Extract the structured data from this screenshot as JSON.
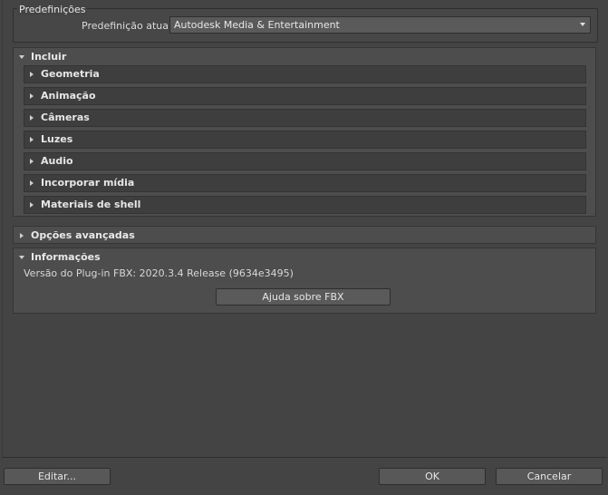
{
  "presets": {
    "title": "Predefinições",
    "current_label": "Predefinição atual:",
    "current_value": "Autodesk Media & Entertainment"
  },
  "include": {
    "title": "Incluir",
    "items": [
      {
        "label": "Geometria"
      },
      {
        "label": "Animação"
      },
      {
        "label": "Câmeras"
      },
      {
        "label": "Luzes"
      },
      {
        "label": "Audio"
      },
      {
        "label": "Incorporar mídia"
      },
      {
        "label": "Materiais de shell"
      }
    ]
  },
  "advanced": {
    "title": "Opções avançadas"
  },
  "info": {
    "title": "Informações",
    "version": "Versão do Plug-in FBX: 2020.3.4 Release (9634e3495)",
    "help_button": "Ajuda sobre FBX"
  },
  "footer": {
    "edit_button": "Editar...",
    "ok_button": "OK",
    "cancel_button": "Cancelar"
  }
}
